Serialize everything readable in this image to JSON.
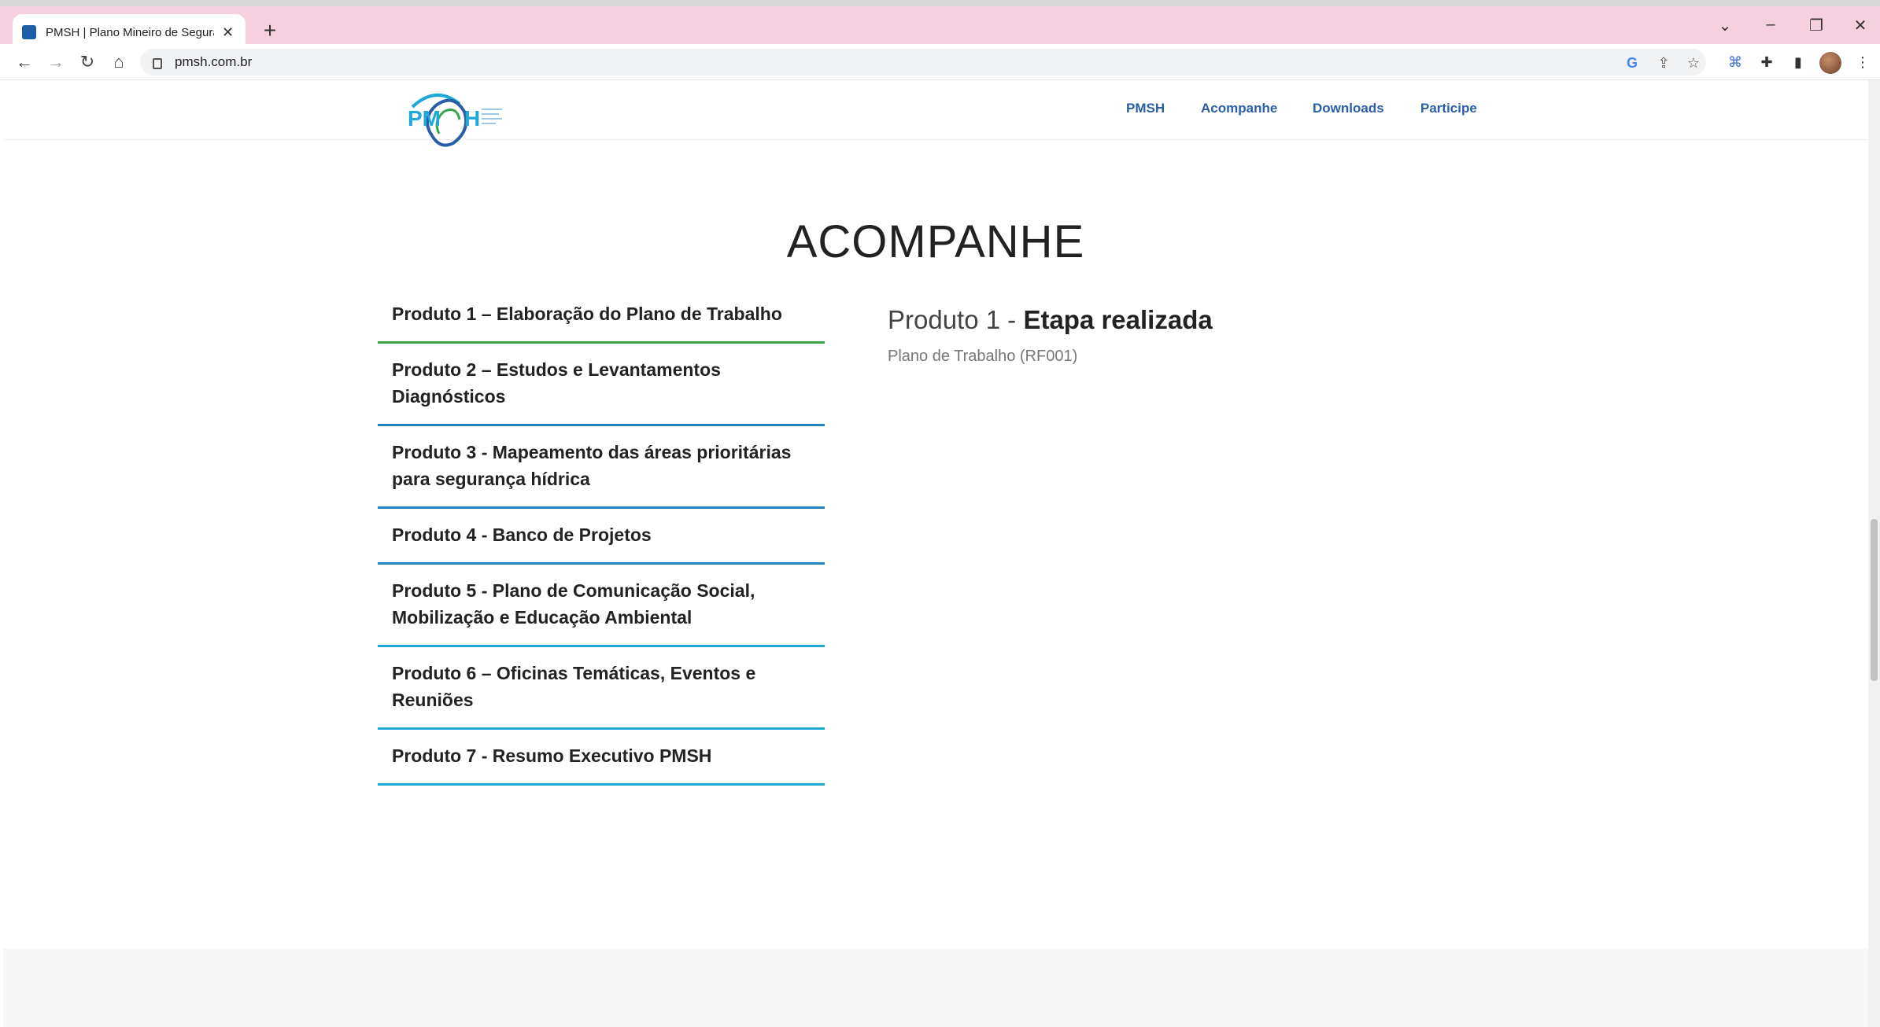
{
  "browser": {
    "tab_title": "PMSH | Plano Mineiro de Segura",
    "tab_close_icon": "close-icon",
    "new_tab_label": "+",
    "url": "pmsh.com.br",
    "window_controls": [
      "chevron-down-icon",
      "minimize-icon",
      "restore-icon",
      "close-icon"
    ]
  },
  "site": {
    "nav": [
      "PMSH",
      "Acompanhe",
      "Downloads",
      "Participe"
    ],
    "page_title": "ACOMPANHE"
  },
  "accordion": [
    "Produto 1 – Elaboração do Plano de Trabalho",
    "Produto 2 – Estudos e Levantamentos Diagnósticos",
    "Produto 3 - Mapeamento das áreas prioritárias para segurança hídrica",
    "Produto 4 - Banco de Projetos",
    "Produto 5 - Plano de Comunicação Social, Mobilização e Educação Ambiental",
    "Produto 6 – Oficinas Temáticas, Eventos e Reuniões",
    "Produto 7 - Resumo Executivo PMSH"
  ],
  "panel": {
    "title_prefix": "Produto 1 - ",
    "title_strong": "Etapa realizada",
    "link": "Plano de Trabalho (RF001)"
  },
  "colors": {
    "nav_blue": "#2a5ea6",
    "accent_green": "#3aa54a",
    "accent_blue": "#2a7fc1",
    "accent_cyan": "#1fa9d6",
    "tabstrip_pink": "#f5d1e0"
  }
}
